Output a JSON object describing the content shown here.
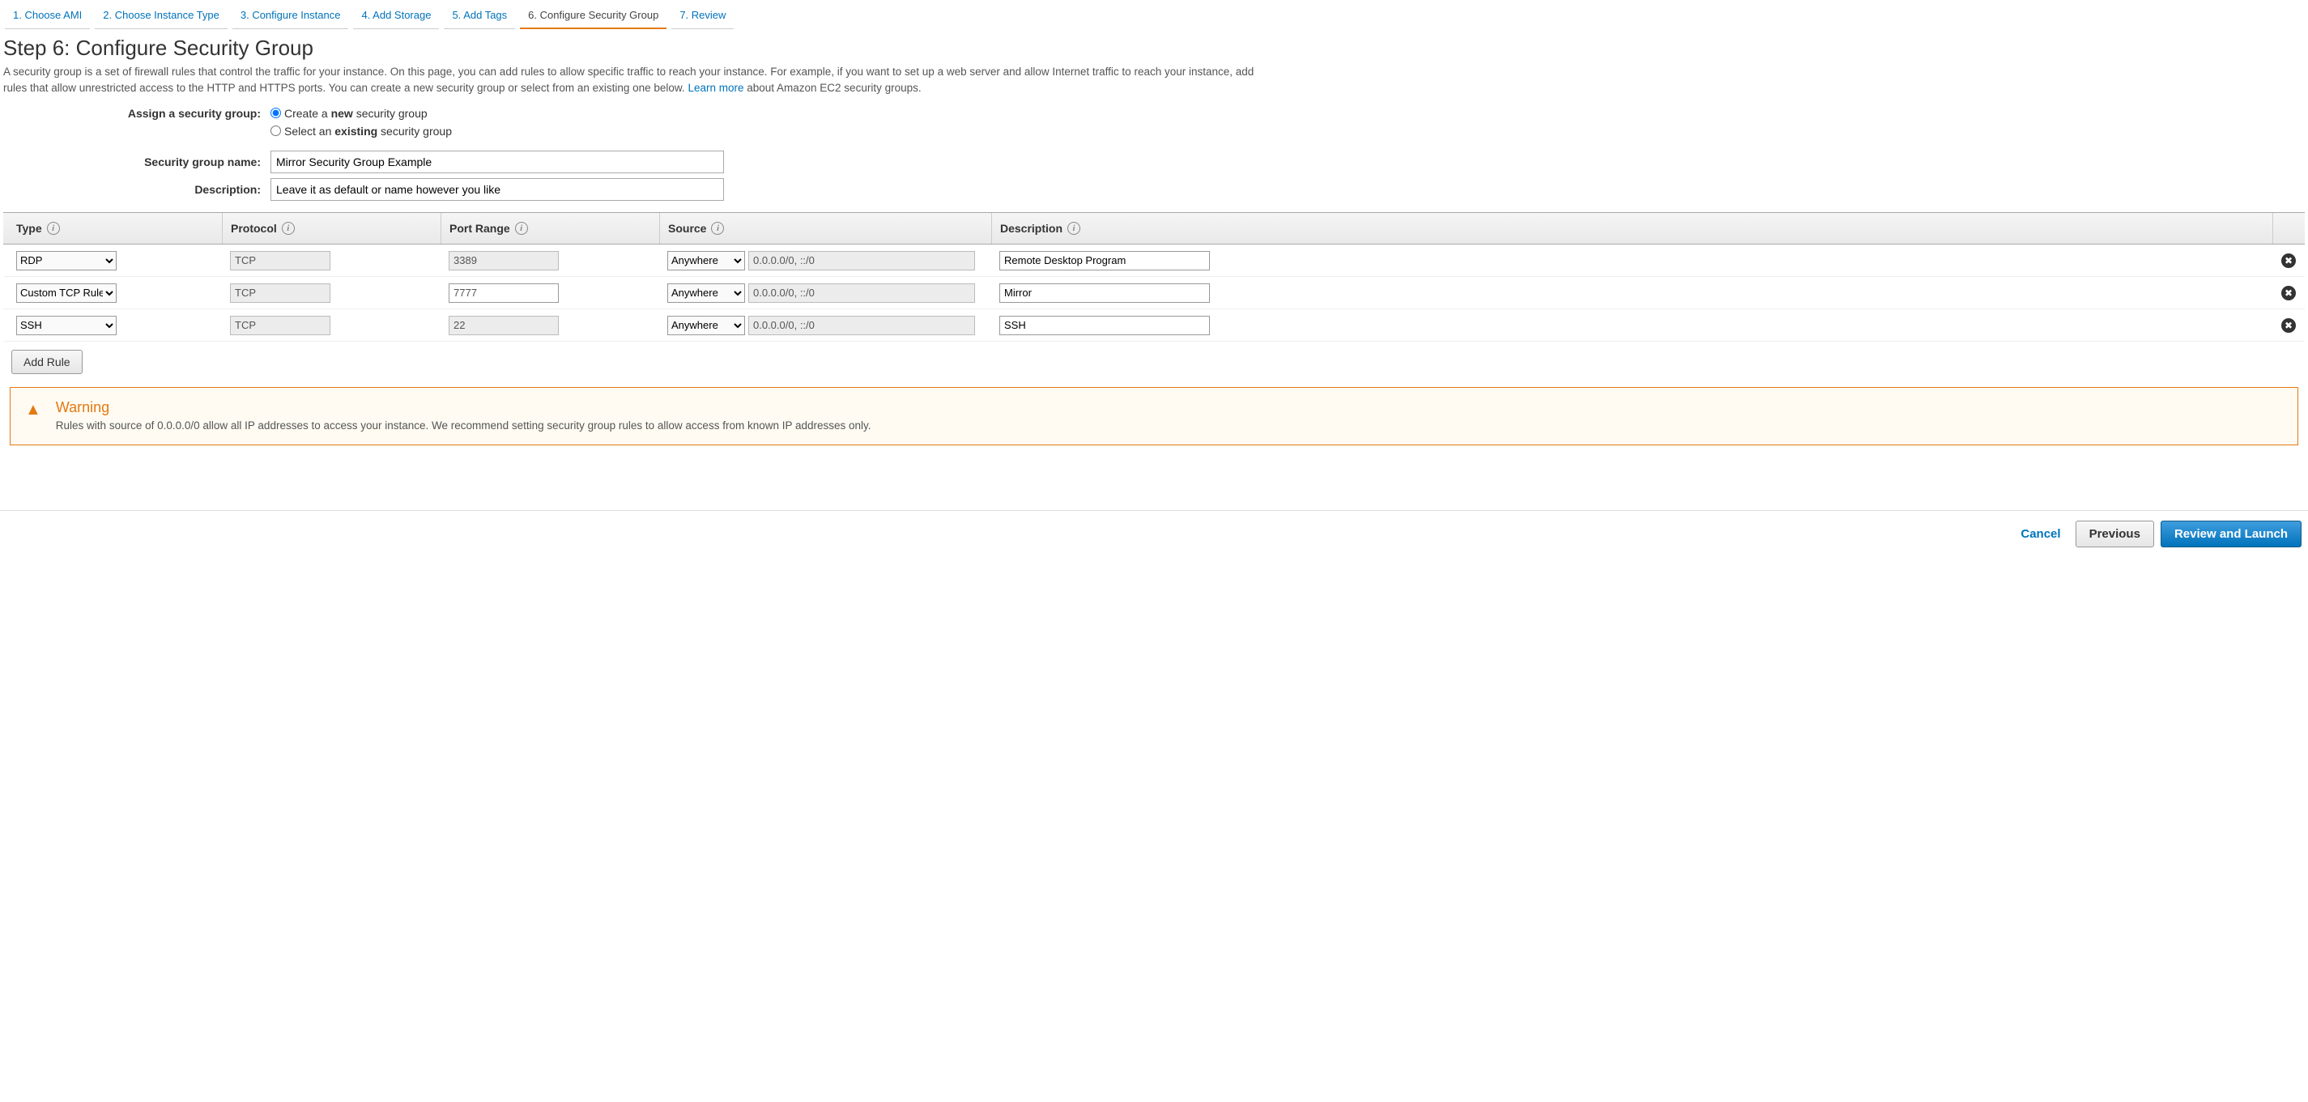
{
  "wizard": {
    "steps": [
      {
        "label": "1. Choose AMI"
      },
      {
        "label": "2. Choose Instance Type"
      },
      {
        "label": "3. Configure Instance"
      },
      {
        "label": "4. Add Storage"
      },
      {
        "label": "5. Add Tags"
      },
      {
        "label": "6. Configure Security Group"
      },
      {
        "label": "7. Review"
      }
    ],
    "active_index": 5
  },
  "page_title": "Step 6: Configure Security Group",
  "description_1": "A security group is a set of firewall rules that control the traffic for your instance. On this page, you can add rules to allow specific traffic to reach your instance. For example, if you want to set up a web server and allow Internet traffic to reach your instance, add rules that allow unrestricted access to the HTTP and HTTPS ports. You can create a new security group or select from an existing one below. ",
  "learn_more": "Learn more",
  "description_2": " about Amazon EC2 security groups.",
  "assign_label": "Assign a security group:",
  "radio_create_pre": "Create a ",
  "radio_create_bold": "new",
  "radio_create_post": " security group",
  "radio_select_pre": "Select an ",
  "radio_select_bold": "existing",
  "radio_select_post": " security group",
  "name_label": "Security group name:",
  "name_value": "Mirror Security Group Example",
  "desc_label": "Description:",
  "desc_value": "Leave it as default or name however you like",
  "columns": {
    "type": "Type",
    "protocol": "Protocol",
    "port": "Port Range",
    "source": "Source",
    "description": "Description"
  },
  "rules": [
    {
      "type": "RDP",
      "protocol": "TCP",
      "port": "3389",
      "port_editable": false,
      "source_sel": "Anywhere",
      "source_val": "0.0.0.0/0, ::/0",
      "description": "Remote Desktop Program"
    },
    {
      "type": "Custom TCP Rule",
      "protocol": "TCP",
      "port": "7777",
      "port_editable": true,
      "source_sel": "Anywhere",
      "source_val": "0.0.0.0/0, ::/0",
      "description": "Mirror"
    },
    {
      "type": "SSH",
      "protocol": "TCP",
      "port": "22",
      "port_editable": false,
      "source_sel": "Anywhere",
      "source_val": "0.0.0.0/0, ::/0",
      "description": "SSH"
    }
  ],
  "add_rule_label": "Add Rule",
  "warning": {
    "title": "Warning",
    "text": "Rules with source of 0.0.0.0/0 allow all IP addresses to access your instance. We recommend setting security group rules to allow access from known IP addresses only."
  },
  "footer": {
    "cancel": "Cancel",
    "previous": "Previous",
    "review": "Review and Launch"
  }
}
